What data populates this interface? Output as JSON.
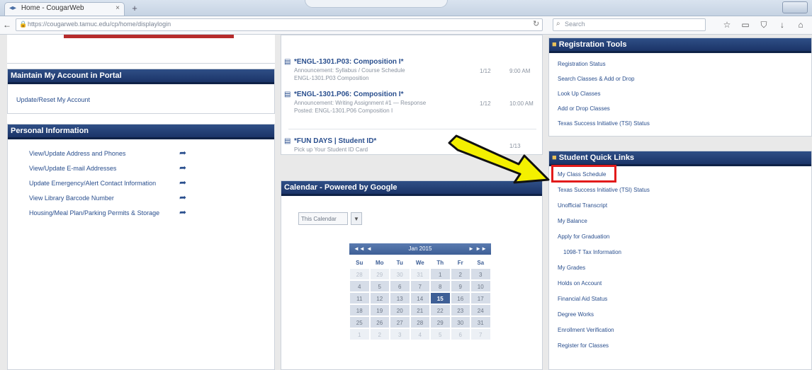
{
  "browser": {
    "tab_title": "Home - CougarWeb",
    "tab_close": "×",
    "new_tab": "+",
    "window_button": "",
    "url": "https://cougarweb.tamuc.edu/cp/home/displaylogin",
    "search_placeholder": "Search",
    "toolbar_icons": [
      "star-icon",
      "clipboard-icon",
      "shield-icon",
      "download-icon",
      "home-icon"
    ]
  },
  "left": {
    "account_header": "Maintain My Account in Portal",
    "account_link": "Update/Reset My Account",
    "personal_header": "Personal Information",
    "personal_links": [
      "View/Update Address and Phones",
      "View/Update E-mail Addresses",
      "Update Emergency/Alert Contact Information",
      "View Library Barcode Number",
      "Housing/Meal Plan/Parking Permits & Storage"
    ]
  },
  "middle": {
    "courses": [
      {
        "title": "*ENGL-1301.P03: Composition I*",
        "sub1": "Announcement: Syllabus / Course Schedule",
        "sub2": "ENGL-1301.P03 Composition",
        "meta1": "1/12",
        "meta2": "9:00 AM"
      },
      {
        "title": "*ENGL-1301.P06: Composition I*",
        "sub1": "Announcement: Writing Assignment #1 — Response",
        "sub2": "Posted: ENGL-1301.P06 Composition I",
        "meta1": "1/12",
        "meta2": "10:00 AM"
      },
      {
        "title": "*FUN DAYS | Student ID*",
        "sub1": "Pick up Your Student ID Card",
        "sub2": "",
        "meta1": "",
        "meta2": "1/13"
      }
    ],
    "calendar_header": "Calendar - Powered by Google",
    "calendar_select": "This Calendar",
    "calendar_select_btn": "▼",
    "calendar": {
      "prev": "◄◄ ◄",
      "next": "► ►►",
      "month": "Jan 2015",
      "dow": [
        "Su",
        "Mo",
        "Tu",
        "We",
        "Th",
        "Fr",
        "Sa"
      ],
      "weeks": [
        [
          "28",
          "29",
          "30",
          "31",
          "1",
          "2",
          "3"
        ],
        [
          "4",
          "5",
          "6",
          "7",
          "8",
          "9",
          "10"
        ],
        [
          "11",
          "12",
          "13",
          "14",
          "15",
          "16",
          "17"
        ],
        [
          "18",
          "19",
          "20",
          "21",
          "22",
          "23",
          "24"
        ],
        [
          "25",
          "26",
          "27",
          "28",
          "29",
          "30",
          "31"
        ],
        [
          "1",
          "2",
          "3",
          "4",
          "5",
          "6",
          "7"
        ]
      ],
      "today": "15"
    }
  },
  "right": {
    "top_header": "Registration Tools",
    "top_links": [
      "Registration Status",
      "Search Classes & Add or Drop",
      "Look Up Classes",
      "Add or Drop Classes",
      "Texas Success Initiative (TSI) Status"
    ],
    "quick_header": "Student Quick Links",
    "quick_links": [
      "My Class Schedule",
      "Texas Success Initiative (TSI) Status",
      "Unofficial Transcript",
      "My Balance",
      "Apply for Graduation",
      "1098-T Tax Information",
      "My Grades",
      "Holds on Account",
      "Financial Aid Status",
      "Degree Works",
      "Enrollment Verification",
      "Register for Classes"
    ]
  }
}
